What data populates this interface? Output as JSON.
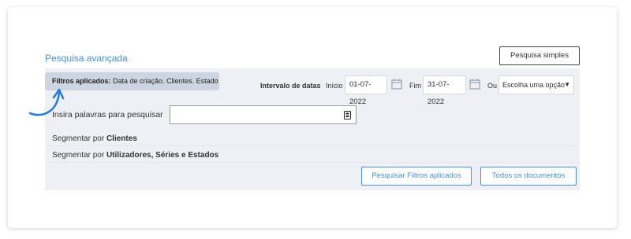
{
  "header": {
    "title": "Pesquisa avançada",
    "simple_search_label": "Pesquisa simples"
  },
  "filters": {
    "applied_label": "Filtros aplicados:",
    "applied_value": "Data de criação. Clientes. Estado"
  },
  "dates": {
    "interval_label": "Intervalo de datas",
    "start_label": "Início",
    "start_value": "01-07-2022",
    "end_label": "Fim",
    "end_value": "31-07-2022",
    "or_label": "Ou",
    "select_value": "Escolha uma opção"
  },
  "search": {
    "label": "Insira palavras para pesquisar",
    "value": ""
  },
  "segments": {
    "prefix": "Segmentar por",
    "clients": "Clientes",
    "users": "Utilizadores, Séries e Estados"
  },
  "actions": {
    "search_filters_label": "Pesquisar Filtros aplicados",
    "all_docs_label": "Todos os documentos"
  },
  "colors": {
    "accent": "#4a90d9",
    "panel": "#eef0f5",
    "pill": "#cdd5e2"
  }
}
